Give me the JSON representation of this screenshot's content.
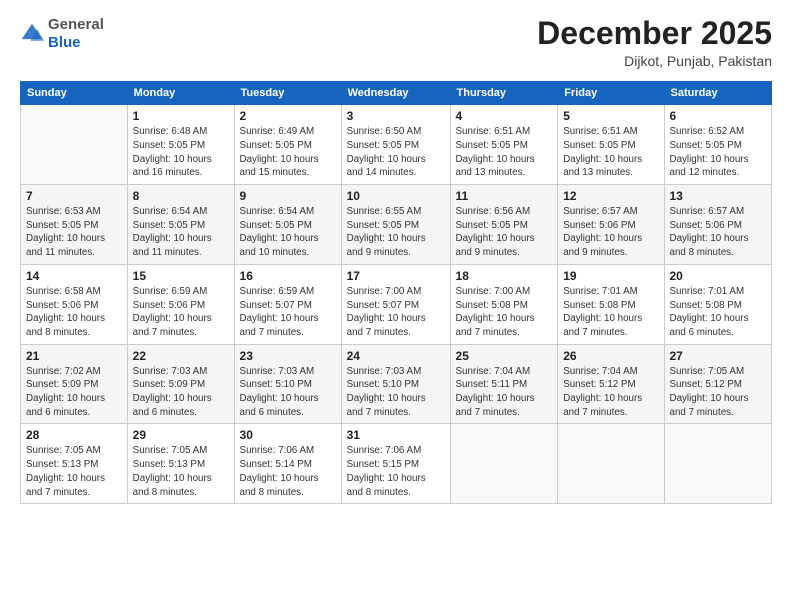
{
  "header": {
    "logo": {
      "general": "General",
      "blue": "Blue"
    },
    "title": "December 2025",
    "location": "Dijkot, Punjab, Pakistan"
  },
  "weekdays": [
    "Sunday",
    "Monday",
    "Tuesday",
    "Wednesday",
    "Thursday",
    "Friday",
    "Saturday"
  ],
  "weeks": [
    [
      {
        "day": "",
        "info": ""
      },
      {
        "day": "1",
        "info": "Sunrise: 6:48 AM\nSunset: 5:05 PM\nDaylight: 10 hours\nand 16 minutes."
      },
      {
        "day": "2",
        "info": "Sunrise: 6:49 AM\nSunset: 5:05 PM\nDaylight: 10 hours\nand 15 minutes."
      },
      {
        "day": "3",
        "info": "Sunrise: 6:50 AM\nSunset: 5:05 PM\nDaylight: 10 hours\nand 14 minutes."
      },
      {
        "day": "4",
        "info": "Sunrise: 6:51 AM\nSunset: 5:05 PM\nDaylight: 10 hours\nand 13 minutes."
      },
      {
        "day": "5",
        "info": "Sunrise: 6:51 AM\nSunset: 5:05 PM\nDaylight: 10 hours\nand 13 minutes."
      },
      {
        "day": "6",
        "info": "Sunrise: 6:52 AM\nSunset: 5:05 PM\nDaylight: 10 hours\nand 12 minutes."
      }
    ],
    [
      {
        "day": "7",
        "info": "Sunrise: 6:53 AM\nSunset: 5:05 PM\nDaylight: 10 hours\nand 11 minutes."
      },
      {
        "day": "8",
        "info": "Sunrise: 6:54 AM\nSunset: 5:05 PM\nDaylight: 10 hours\nand 11 minutes."
      },
      {
        "day": "9",
        "info": "Sunrise: 6:54 AM\nSunset: 5:05 PM\nDaylight: 10 hours\nand 10 minutes."
      },
      {
        "day": "10",
        "info": "Sunrise: 6:55 AM\nSunset: 5:05 PM\nDaylight: 10 hours\nand 9 minutes."
      },
      {
        "day": "11",
        "info": "Sunrise: 6:56 AM\nSunset: 5:05 PM\nDaylight: 10 hours\nand 9 minutes."
      },
      {
        "day": "12",
        "info": "Sunrise: 6:57 AM\nSunset: 5:06 PM\nDaylight: 10 hours\nand 9 minutes."
      },
      {
        "day": "13",
        "info": "Sunrise: 6:57 AM\nSunset: 5:06 PM\nDaylight: 10 hours\nand 8 minutes."
      }
    ],
    [
      {
        "day": "14",
        "info": "Sunrise: 6:58 AM\nSunset: 5:06 PM\nDaylight: 10 hours\nand 8 minutes."
      },
      {
        "day": "15",
        "info": "Sunrise: 6:59 AM\nSunset: 5:06 PM\nDaylight: 10 hours\nand 7 minutes."
      },
      {
        "day": "16",
        "info": "Sunrise: 6:59 AM\nSunset: 5:07 PM\nDaylight: 10 hours\nand 7 minutes."
      },
      {
        "day": "17",
        "info": "Sunrise: 7:00 AM\nSunset: 5:07 PM\nDaylight: 10 hours\nand 7 minutes."
      },
      {
        "day": "18",
        "info": "Sunrise: 7:00 AM\nSunset: 5:08 PM\nDaylight: 10 hours\nand 7 minutes."
      },
      {
        "day": "19",
        "info": "Sunrise: 7:01 AM\nSunset: 5:08 PM\nDaylight: 10 hours\nand 7 minutes."
      },
      {
        "day": "20",
        "info": "Sunrise: 7:01 AM\nSunset: 5:08 PM\nDaylight: 10 hours\nand 6 minutes."
      }
    ],
    [
      {
        "day": "21",
        "info": "Sunrise: 7:02 AM\nSunset: 5:09 PM\nDaylight: 10 hours\nand 6 minutes."
      },
      {
        "day": "22",
        "info": "Sunrise: 7:03 AM\nSunset: 5:09 PM\nDaylight: 10 hours\nand 6 minutes."
      },
      {
        "day": "23",
        "info": "Sunrise: 7:03 AM\nSunset: 5:10 PM\nDaylight: 10 hours\nand 6 minutes."
      },
      {
        "day": "24",
        "info": "Sunrise: 7:03 AM\nSunset: 5:10 PM\nDaylight: 10 hours\nand 7 minutes."
      },
      {
        "day": "25",
        "info": "Sunrise: 7:04 AM\nSunset: 5:11 PM\nDaylight: 10 hours\nand 7 minutes."
      },
      {
        "day": "26",
        "info": "Sunrise: 7:04 AM\nSunset: 5:12 PM\nDaylight: 10 hours\nand 7 minutes."
      },
      {
        "day": "27",
        "info": "Sunrise: 7:05 AM\nSunset: 5:12 PM\nDaylight: 10 hours\nand 7 minutes."
      }
    ],
    [
      {
        "day": "28",
        "info": "Sunrise: 7:05 AM\nSunset: 5:13 PM\nDaylight: 10 hours\nand 7 minutes."
      },
      {
        "day": "29",
        "info": "Sunrise: 7:05 AM\nSunset: 5:13 PM\nDaylight: 10 hours\nand 8 minutes."
      },
      {
        "day": "30",
        "info": "Sunrise: 7:06 AM\nSunset: 5:14 PM\nDaylight: 10 hours\nand 8 minutes."
      },
      {
        "day": "31",
        "info": "Sunrise: 7:06 AM\nSunset: 5:15 PM\nDaylight: 10 hours\nand 8 minutes."
      },
      {
        "day": "",
        "info": ""
      },
      {
        "day": "",
        "info": ""
      },
      {
        "day": "",
        "info": ""
      }
    ]
  ]
}
